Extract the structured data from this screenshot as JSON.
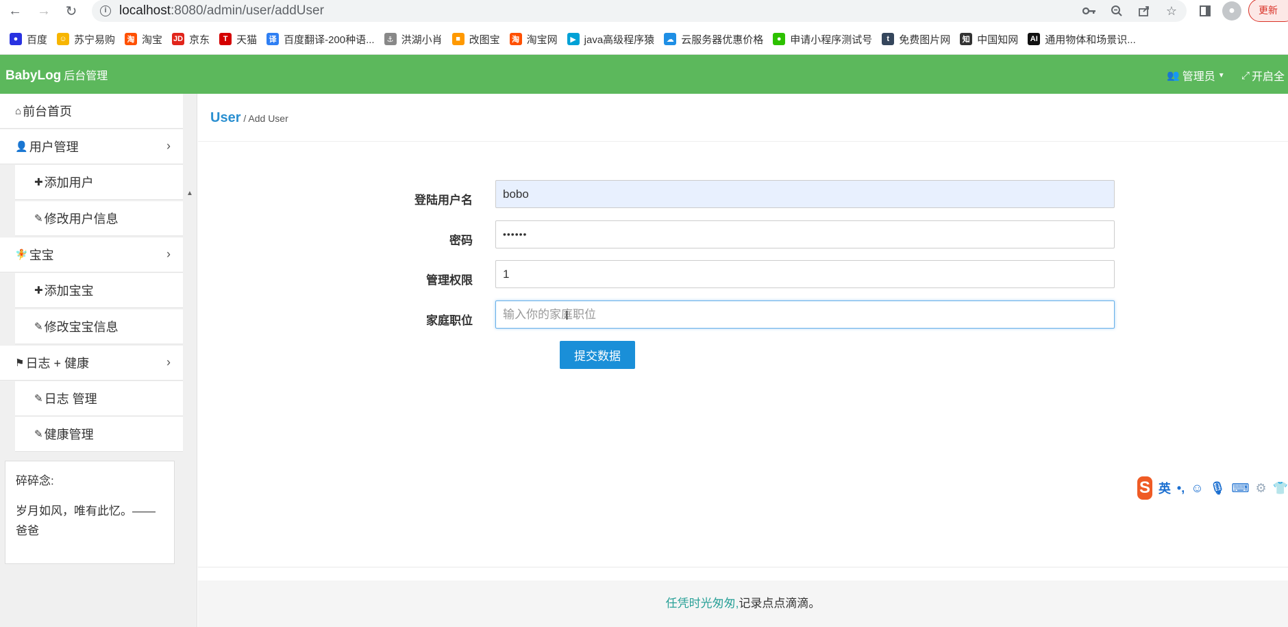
{
  "browser": {
    "url_host": "localhost",
    "url_rest": ":8080/admin/user/addUser",
    "update_label": "更新",
    "bookmarks": [
      {
        "label": "百度",
        "icon": "baidu-icon",
        "color": "#2932e1"
      },
      {
        "label": "苏宁易购",
        "icon": "suning-icon",
        "color": "#f7b500"
      },
      {
        "label": "淘宝",
        "icon": "taobao-icon",
        "color": "#ff5000"
      },
      {
        "label": "京东",
        "icon": "jd-icon",
        "color": "#e1251b"
      },
      {
        "label": "天猫",
        "icon": "tmall-icon",
        "color": "#d40000"
      },
      {
        "label": "百度翻译-200种语...",
        "icon": "baidu-translate-icon",
        "color": "#2f7ff3"
      },
      {
        "label": "洪湖小肖",
        "icon": "hhxx-icon",
        "color": "#888888"
      },
      {
        "label": "改图宝",
        "icon": "gaitubao-icon",
        "color": "#ff9900"
      },
      {
        "label": "淘宝网",
        "icon": "taobao-net-icon",
        "color": "#ff5000"
      },
      {
        "label": "java高级程序猿",
        "icon": "bilibili-icon",
        "color": "#00a1d6"
      },
      {
        "label": "云服务器优惠价格",
        "icon": "cloud-icon",
        "color": "#1f8fe5"
      },
      {
        "label": "申请小程序测试号",
        "icon": "wechat-icon",
        "color": "#2dc100"
      },
      {
        "label": "免费图片网",
        "icon": "tumblr-icon",
        "color": "#35465c"
      },
      {
        "label": "中国知网",
        "icon": "cnki-icon",
        "color": "#333333"
      },
      {
        "label": "通用物体和场景识...",
        "icon": "ai-icon",
        "color": "#111111"
      }
    ]
  },
  "header": {
    "brand": "BabyLog",
    "brand_sub": "后台管理",
    "admin_label": "管理员",
    "fullscreen_label": "开启全"
  },
  "sidebar": {
    "items": [
      {
        "label": "前台首页",
        "icon": "home-icon"
      },
      {
        "label": "用户管理",
        "icon": "user-icon"
      },
      {
        "label": "添加用户",
        "icon": "plus-icon"
      },
      {
        "label": "修改用户信息",
        "icon": "edit-icon"
      },
      {
        "label": "宝宝",
        "icon": "child-icon"
      },
      {
        "label": "添加宝宝",
        "icon": "plus-icon"
      },
      {
        "label": "修改宝宝信息",
        "icon": "edit-icon"
      },
      {
        "label": "日志 + 健康",
        "icon": "flag-icon"
      },
      {
        "label": "日志 管理",
        "icon": "edit-icon"
      },
      {
        "label": "健康管理",
        "icon": "edit-icon"
      }
    ],
    "note_title": "碎碎念:",
    "note_body": "岁月如风，唯有此忆。——爸爸"
  },
  "main": {
    "breadcrumb_main": "User",
    "breadcrumb_sep": " / ",
    "breadcrumb_sub": "Add User",
    "form": {
      "username_label": "登陆用户名",
      "username_value": "bobo",
      "password_label": "密码",
      "password_value": "••••••",
      "permission_label": "管理权限",
      "permission_value": "1",
      "role_label": "家庭职位",
      "role_placeholder": "输入你的家庭职位",
      "submit_label": "提交数据"
    }
  },
  "footer": {
    "accent_text": "任凭时光匆匆,",
    "text": "记录点点滴滴。"
  },
  "ime": {
    "logo": "S",
    "mode": "英"
  }
}
